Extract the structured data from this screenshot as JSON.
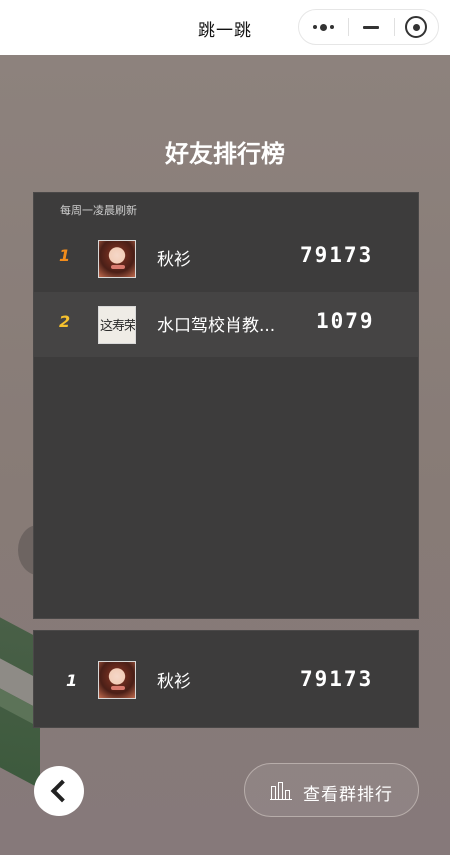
{
  "nav": {
    "title": "跳一跳",
    "more_icon": "more-dots-icon",
    "minimize_icon": "minimize-icon",
    "close_icon": "close-target-icon"
  },
  "board": {
    "title": "好友排行榜",
    "refresh_note": "每周一凌晨刷新",
    "rows": [
      {
        "rank": "1",
        "avatar": "portrait-avatar",
        "name": "秋衫",
        "score": "79173"
      },
      {
        "rank": "2",
        "avatar": "calligraphy-avatar",
        "avatar_text": "这寿荣",
        "name": "水口驾校肖教...",
        "score": "1079"
      }
    ]
  },
  "self": {
    "rank": "1",
    "avatar": "portrait-avatar",
    "name": "秋衫",
    "score": "79173"
  },
  "controls": {
    "back_icon": "chevron-left-icon",
    "group_icon": "bar-chart-icon",
    "group_label": "查看群排行"
  },
  "colors": {
    "rank_1": "#f28c1b",
    "rank_2": "#f5c12e",
    "panel_bg": "#3d3c3c",
    "stage_bg": "#8b807b"
  }
}
